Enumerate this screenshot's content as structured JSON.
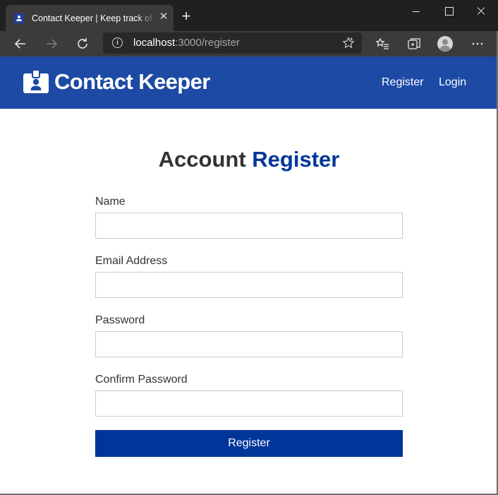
{
  "browser": {
    "tab_title": "Contact Keeper | Keep track of your contacts",
    "tab_close_icon": "close-icon",
    "new_tab_label": "+",
    "window_controls": [
      "minimize-icon",
      "maximize-icon",
      "close-icon"
    ],
    "address": {
      "host": "localhost",
      "path": ":3000/register",
      "info_glyph": "i"
    },
    "toolbar_icons": [
      "back-arrow-icon",
      "forward-arrow-icon",
      "refresh-icon",
      "favorites-star-icon",
      "favorites-list-icon",
      "collections-icon",
      "profile-avatar-icon",
      "more-options-icon"
    ]
  },
  "navbar": {
    "brand": "Contact Keeper",
    "brand_icon": "id-badge-icon",
    "links": [
      {
        "label": "Register"
      },
      {
        "label": "Login"
      }
    ]
  },
  "form": {
    "heading_prefix": "Account",
    "heading_accent": "Register",
    "fields": [
      {
        "label": "Name",
        "value": "",
        "type": "text"
      },
      {
        "label": "Email Address",
        "value": "",
        "type": "email"
      },
      {
        "label": "Password",
        "value": "",
        "type": "password"
      },
      {
        "label": "Confirm Password",
        "value": "",
        "type": "password"
      }
    ],
    "submit_label": "Register"
  },
  "colors": {
    "navbar_bg": "#1c4aa4",
    "primary": "#003699",
    "text": "#333333",
    "browser_titlebar": "#202020",
    "browser_toolbar": "#3b3b3b"
  }
}
